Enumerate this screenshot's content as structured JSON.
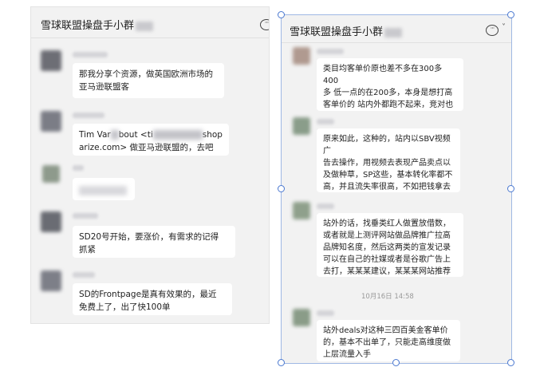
{
  "left_window": {
    "title": "雪球联盟操盘手小群",
    "more_icon_glyph": "···",
    "messages": [
      {
        "text": "那我分享个资源，做英国欧洲市场的\n亚马逊联盟客"
      },
      {
        "text_before": "Tim Var",
        "text_mid": "bout <ti",
        "text_after": "shop\narize.com> 做亚马逊联盟的，去吧"
      },
      {
        "text": ""
      },
      {
        "text": "SD20号开始，要涨价，有需求的记得\n抓紧"
      },
      {
        "text": "SD的Frontpage是真有效果的，最近\n免费上了，出了快100单"
      }
    ]
  },
  "right_window": {
    "title": "雪球联盟操盘手小群",
    "more_icon_glyph": "···",
    "chevron": "˅",
    "messages": [
      {
        "text": "类目均客单价原也差不多在300多400\n多 低一点的在200多，本身是想打高\n客单价的 站内外都跑不起来，竞对也\n一直在降价 我们也退看调价😂"
      },
      {
        "text": "原来如此，这种的，站内以SBV视频广\n告去操作，用视频去表现产品卖点以\n及做种草，SP这些，基本转化率都不\n高，并且流失率很高，不如把钱拿去\n投meta和谷歌"
      },
      {
        "text": "站外的话，找垂类红人做置放借数，\n或者就是上测评网站做品牌推广拉高\n品牌知名度，然后这两类的宣发记录\n可以在自己的社媒或者是谷歌广告上\n去打，某某某建议，某某某网站推荐"
      },
      {
        "text": "站外deals对这种三四百美金客单价\n的，基本不出单了，只能走高维度做\n上层流量入手"
      }
    ],
    "timestamp": "10月16日 14:58"
  },
  "colors": {
    "panel_bg": "#f2f2f2",
    "bubble_bg": "#ffffff",
    "selection_border": "#4a78d0"
  }
}
